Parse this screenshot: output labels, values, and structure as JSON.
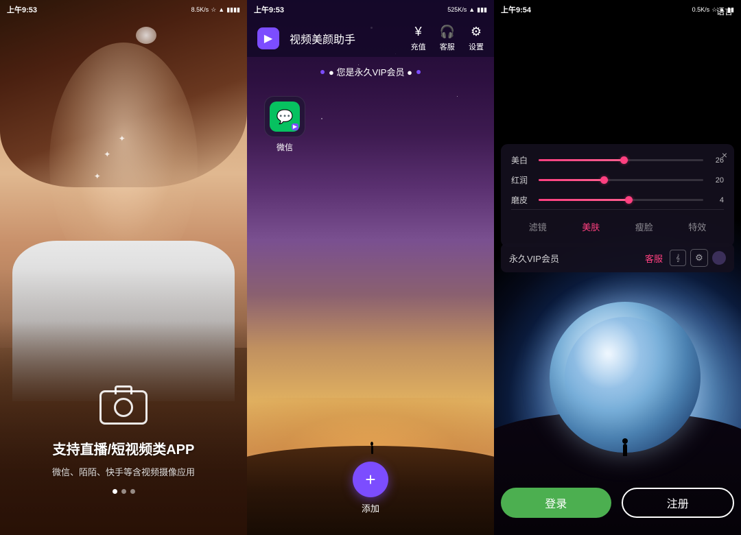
{
  "panel1": {
    "status_time": "上午9:53",
    "status_info": "8.5K/s ★ ⊙ 📶 🔋",
    "title": "支持直播/短视频类APP",
    "subtitle": "微信、陌陌、快手等含视频摄像应用",
    "dots": [
      true,
      false,
      false
    ],
    "sparkles": [
      "✦",
      "✦",
      "✦"
    ]
  },
  "panel2": {
    "status_time": "上午9:53",
    "status_info": "525K/s ★ ⊙ 📶 🔋",
    "app_name": "视频美颜助手",
    "nav_recharge": "充值",
    "nav_service": "客服",
    "nav_settings": "设置",
    "vip_text": "● 您是永久VIP会员 ●",
    "wechat_label": "微信",
    "add_label": "添加"
  },
  "panel3": {
    "status_time": "上午9:54",
    "status_info": "0.5K/s ★ ⊙ 📶 🔋",
    "lang_button": "语言",
    "close_btn": "×",
    "sliders": [
      {
        "label": "美白",
        "value": 26,
        "percent": 52
      },
      {
        "label": "红润",
        "value": 20,
        "percent": 40
      },
      {
        "label": "磨皮",
        "value": 4,
        "percent": 55
      }
    ],
    "tabs": [
      {
        "label": "滤镜",
        "active": false
      },
      {
        "label": "美肤",
        "active": true
      },
      {
        "label": "瘦脸",
        "active": false
      },
      {
        "label": "特效",
        "active": false
      }
    ],
    "vip_text": "永久VIP会员",
    "vip_service": "客服",
    "login_btn": "登录",
    "register_btn": "注册"
  }
}
